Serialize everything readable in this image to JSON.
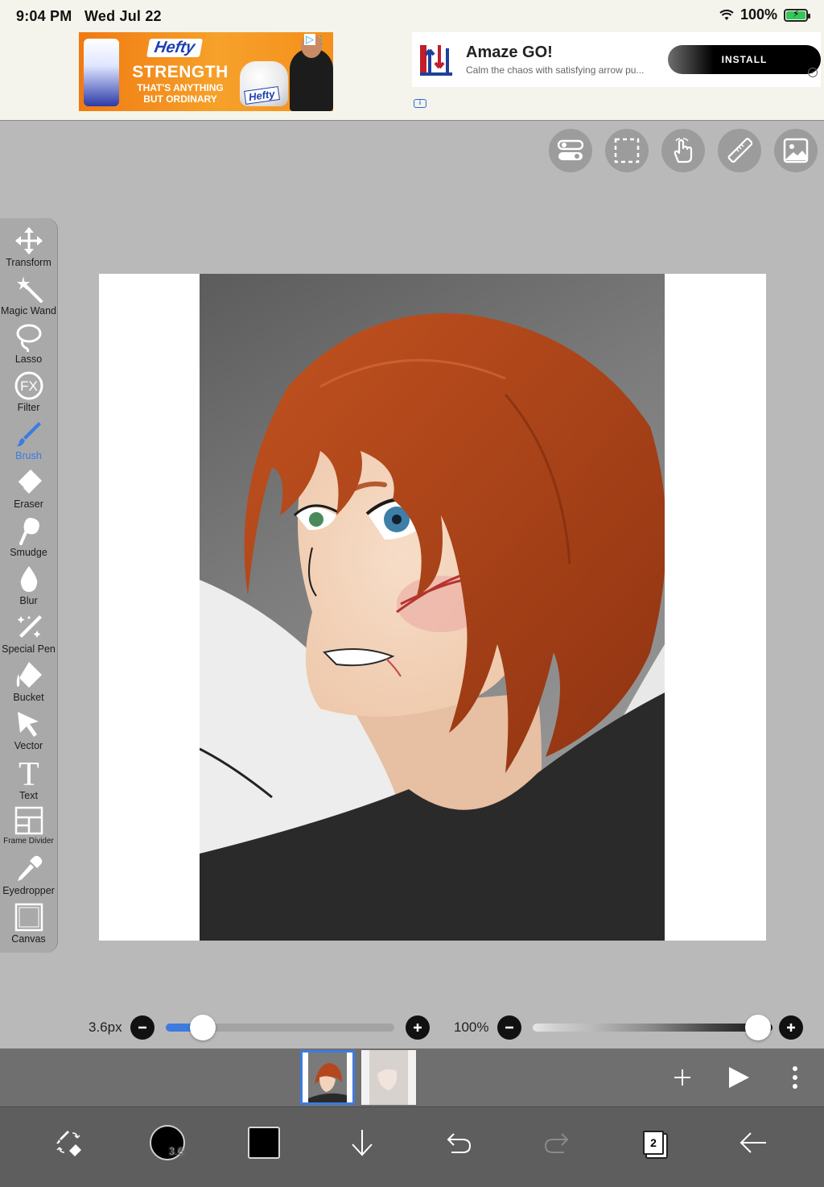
{
  "status": {
    "time": "9:04 PM",
    "date": "Wed Jul 22",
    "battery": "100%"
  },
  "ad_banner": {
    "brand": "Hefty",
    "headline": "STRENGTH",
    "subline_1": "THAT'S ANYTHING",
    "subline_2": "BUT ORDINARY",
    "bag_label": "Hefty"
  },
  "ad_card": {
    "title": "Amaze GO!",
    "description": "Calm the chaos with satisfying arrow pu...",
    "install_label": "INSTALL"
  },
  "top_tools": [
    {
      "name": "toggle-icon"
    },
    {
      "name": "selection-icon"
    },
    {
      "name": "hand-gesture-icon"
    },
    {
      "name": "ruler-icon"
    },
    {
      "name": "gallery-icon"
    }
  ],
  "tools": {
    "transform": "Transform",
    "magic_wand": "Magic Wand",
    "lasso": "Lasso",
    "filter": "Filter",
    "filter_icon_text": "FX",
    "brush": "Brush",
    "eraser": "Eraser",
    "smudge": "Smudge",
    "blur": "Blur",
    "special_pen": "Special Pen",
    "bucket": "Bucket",
    "vector": "Vector",
    "text": "Text",
    "text_icon_glyph": "T",
    "frame_divider": "Frame Divider",
    "eyedropper": "Eyedropper",
    "canvas": "Canvas",
    "active": "brush"
  },
  "sliders": {
    "brush_size_label": "3.6px",
    "brush_size_fraction": 0.12,
    "opacity_label": "100%",
    "opacity_fraction": 1.0
  },
  "layers": {
    "count": "2",
    "selected_index": 0
  },
  "bottom_bar": {
    "brush_size_badge": "3.6",
    "primary_color": "#000000"
  },
  "colors": {
    "accent": "#3d7be0",
    "hair": "#b4471c",
    "shirt": "#2a2a2a"
  }
}
